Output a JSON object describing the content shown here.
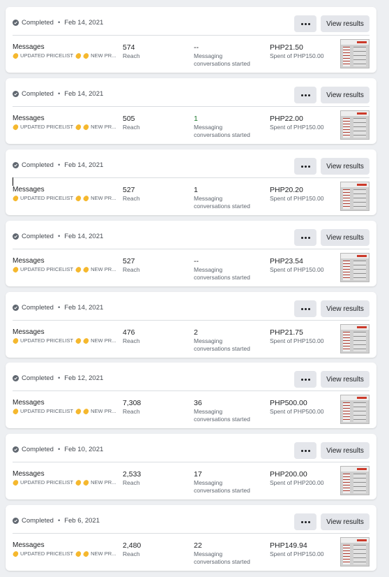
{
  "rows": [
    {
      "status": "Completed",
      "date": "Feb 14, 2021",
      "more_label": "···",
      "view_label": "View results",
      "type": "Messages",
      "creatives": [
        "UPDATED PRICELIST",
        "NEW PR..."
      ],
      "reach": "574",
      "reach_label": "Reach",
      "results": "--",
      "results_label": "Messaging conversations started",
      "spent": "PHP21.50",
      "spent_label": "Spent of PHP150.00"
    },
    {
      "status": "Completed",
      "date": "Feb 14, 2021",
      "more_label": "···",
      "view_label": "View results",
      "type": "Messages",
      "creatives": [
        "UPDATED PRICELIST",
        "NEW PR..."
      ],
      "reach": "505",
      "reach_label": "Reach",
      "results": "1",
      "results_label": "Messaging conversations started",
      "spent": "PHP22.00",
      "spent_label": "Spent of PHP150.00"
    },
    {
      "status": "Completed",
      "date": "Feb 14, 2021",
      "more_label": "···",
      "view_label": "View results",
      "type": "Messages",
      "creatives": [
        "UPDATED PRICELIST",
        "NEW PR..."
      ],
      "reach": "527",
      "reach_label": "Reach",
      "results": "1",
      "results_label": "Messaging conversations started",
      "spent": "PHP20.20",
      "spent_label": "Spent of PHP150.00"
    },
    {
      "status": "Completed",
      "date": "Feb 14, 2021",
      "more_label": "···",
      "view_label": "View results",
      "type": "Messages",
      "creatives": [
        "UPDATED PRICELIST",
        "NEW PR..."
      ],
      "reach": "527",
      "reach_label": "Reach",
      "results": "--",
      "results_label": "Messaging conversations started",
      "spent": "PHP23.54",
      "spent_label": "Spent of PHP150.00"
    },
    {
      "status": "Completed",
      "date": "Feb 14, 2021",
      "more_label": "···",
      "view_label": "View results",
      "type": "Messages",
      "creatives": [
        "UPDATED PRICELIST",
        "NEW PR..."
      ],
      "reach": "476",
      "reach_label": "Reach",
      "results": "2",
      "results_label": "Messaging conversations started",
      "spent": "PHP21.75",
      "spent_label": "Spent of PHP150.00"
    },
    {
      "status": "Completed",
      "date": "Feb 12, 2021",
      "more_label": "···",
      "view_label": "View results",
      "type": "Messages",
      "creatives": [
        "UPDATED PRICELIST",
        "NEW PR..."
      ],
      "reach": "7,308",
      "reach_label": "Reach",
      "results": "36",
      "results_label": "Messaging conversations started",
      "spent": "PHP500.00",
      "spent_label": "Spent of PHP500.00"
    },
    {
      "status": "Completed",
      "date": "Feb 10, 2021",
      "more_label": "···",
      "view_label": "View results",
      "type": "Messages",
      "creatives": [
        "UPDATED PRICELIST",
        "NEW PR..."
      ],
      "reach": "2,533",
      "reach_label": "Reach",
      "results": "17",
      "results_label": "Messaging conversations started",
      "spent": "PHP200.00",
      "spent_label": "Spent of PHP200.00"
    },
    {
      "status": "Completed",
      "date": "Feb 6, 2021",
      "more_label": "···",
      "view_label": "View results",
      "type": "Messages",
      "creatives": [
        "UPDATED PRICELIST",
        "NEW PR..."
      ],
      "reach": "2,480",
      "reach_label": "Reach",
      "results": "22",
      "results_label": "Messaging conversations started",
      "spent": "PHP149.94",
      "spent_label": "Spent of PHP150.00"
    }
  ],
  "icons": {
    "status": "check-circle-icon",
    "creative": "fire-emoji-icon",
    "thumbnail": "product-shelf-thumbnail"
  },
  "colors": {
    "results_highlight": "#1e7a2e",
    "button_bg": "#e4e6eb",
    "page_bg": "#edeff2"
  }
}
